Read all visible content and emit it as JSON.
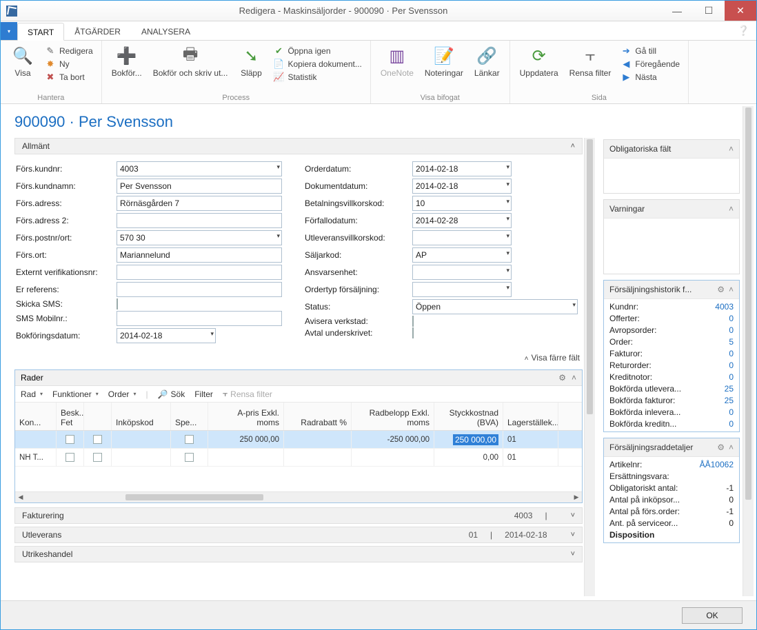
{
  "window": {
    "title": "Redigera - Maskinsäljorder - 900090 · Per Svensson"
  },
  "tabs": {
    "file_caret": "▾",
    "start": "START",
    "actions": "ÅTGÄRDER",
    "analyze": "ANALYSERA"
  },
  "ribbon": {
    "manage": {
      "visa": "Visa",
      "redigera": "Redigera",
      "ny": "Ny",
      "tabort": "Ta bort",
      "label": "Hantera"
    },
    "process": {
      "bokfor": "Bokför...",
      "bokfor_skriv": "Bokför och skriv ut...",
      "slapp": "Släpp",
      "oppna": "Öppna igen",
      "kopiera": "Kopiera dokument...",
      "statistik": "Statistik",
      "label": "Process"
    },
    "attach": {
      "onenote": "OneNote",
      "noteringar": "Noteringar",
      "lankar": "Länkar",
      "label": "Visa bifogat"
    },
    "page": {
      "uppdatera": "Uppdatera",
      "rensa": "Rensa filter",
      "gatill": "Gå till",
      "foreg": "Föregående",
      "nasta": "Nästa",
      "label": "Sida"
    }
  },
  "page": {
    "title": "900090 · Per Svensson",
    "general": "Allmänt",
    "fewer_fields": "Visa färre fält"
  },
  "form": {
    "fors_kundnr_l": "Förs.kundnr:",
    "fors_kundnr_v": "4003",
    "fors_kundnamn_l": "Förs.kundnamn:",
    "fors_kundnamn_v": "Per Svensson",
    "fors_adress_l": "Förs.adress:",
    "fors_adress_v": "Rörnäsgården 7",
    "fors_adress2_l": "Förs.adress 2:",
    "fors_adress2_v": "",
    "fors_postnrort_l": "Förs.postnr/ort:",
    "fors_postnrort_v": "570 30",
    "fors_ort_l": "Förs.ort:",
    "fors_ort_v": "Mariannelund",
    "ext_ver_l": "Externt verifikationsnr:",
    "ext_ver_v": "",
    "er_ref_l": "Er referens:",
    "er_ref_v": "",
    "skicka_sms_l": "Skicka SMS:",
    "sms_mob_l": "SMS Mobilnr.:",
    "sms_mob_v": "",
    "bokfdatum_l": "Bokföringsdatum:",
    "bokfdatum_v": "2014-02-18",
    "orderdatum_l": "Orderdatum:",
    "orderdatum_v": "2014-02-18",
    "dokdatum_l": "Dokumentdatum:",
    "dokdatum_v": "2014-02-18",
    "betvillkor_l": "Betalningsvillkorskod:",
    "betvillkor_v": "10",
    "forfallo_l": "Förfallodatum:",
    "forfallo_v": "2014-02-28",
    "utlev_l": "Utleveransvillkorskod:",
    "utlev_v": "",
    "saljarkod_l": "Säljarkod:",
    "saljarkod_v": "AP",
    "ansvar_l": "Ansvarsenhet:",
    "ansvar_v": "",
    "ordertyp_l": "Ordertyp försäljning:",
    "ordertyp_v": "",
    "status_l": "Status:",
    "status_v": "Öppen",
    "avisera_l": "Avisera verkstad:",
    "avtal_l": "Avtal underskrivet:"
  },
  "rader": {
    "title": "Rader",
    "tb": {
      "rad": "Rad",
      "funktioner": "Funktioner",
      "order": "Order",
      "sok": "Sök",
      "filter": "Filter",
      "rensa": "Rensa filter"
    },
    "head": {
      "kon": "Kon...",
      "besk": "Besk...",
      "besk2": "Fet",
      "inkop": "Inköpskod",
      "spe": "Spe...",
      "apris": "A-pris Exkl.",
      "apris2": "moms",
      "radrabatt": "Radrabatt %",
      "radbelopp": "Radbelopp Exkl.",
      "radbelopp2": "moms",
      "styck": "Styckkostnad",
      "styck2": "(BVA)",
      "lager": "Lagerställek..."
    },
    "rows": [
      {
        "nh": "",
        "apris": "250 000,00",
        "radbelopp": "-250 000,00",
        "styck": "250 000,00",
        "lager": "01"
      },
      {
        "nh": "NH T...",
        "apris": "",
        "radbelopp": "",
        "styck": "0,00",
        "lager": "01"
      }
    ]
  },
  "fakturering": {
    "title": "Fakturering",
    "summary": "4003"
  },
  "utleverans": {
    "title": "Utleverans",
    "s1": "01",
    "s2": "2014-02-18"
  },
  "utrikes": {
    "title": "Utrikeshandel"
  },
  "fb": {
    "obl": "Obligatoriska fält",
    "varn": "Varningar",
    "hist": "Försäljningshistorik f...",
    "hist_rows": [
      [
        "Kundnr:",
        "4003"
      ],
      [
        "Offerter:",
        "0"
      ],
      [
        "Avropsorder:",
        "0"
      ],
      [
        "Order:",
        "5"
      ],
      [
        "Fakturor:",
        "0"
      ],
      [
        "Returorder:",
        "0"
      ],
      [
        "Kreditnotor:",
        "0"
      ],
      [
        "Bokförda utlevera...",
        "25"
      ],
      [
        "Bokförda fakturor:",
        "25"
      ],
      [
        "Bokförda inlevera...",
        "0"
      ],
      [
        "Bokförda kreditn...",
        "0"
      ]
    ],
    "rad": "Försäljningsraddetaljer",
    "rad_rows": [
      [
        "Artikelnr:",
        "ÅÅ10062",
        true
      ],
      [
        "Ersättningsvara:",
        "",
        false
      ],
      [
        "Obligatoriskt antal:",
        "-1",
        false
      ],
      [
        "Antal på inköpsor...",
        "0",
        false
      ],
      [
        "Antal på förs.order:",
        "-1",
        false
      ],
      [
        "Ant. på serviceor...",
        "0",
        false
      ]
    ],
    "disposition": "Disposition"
  },
  "footer": {
    "ok": "OK"
  }
}
